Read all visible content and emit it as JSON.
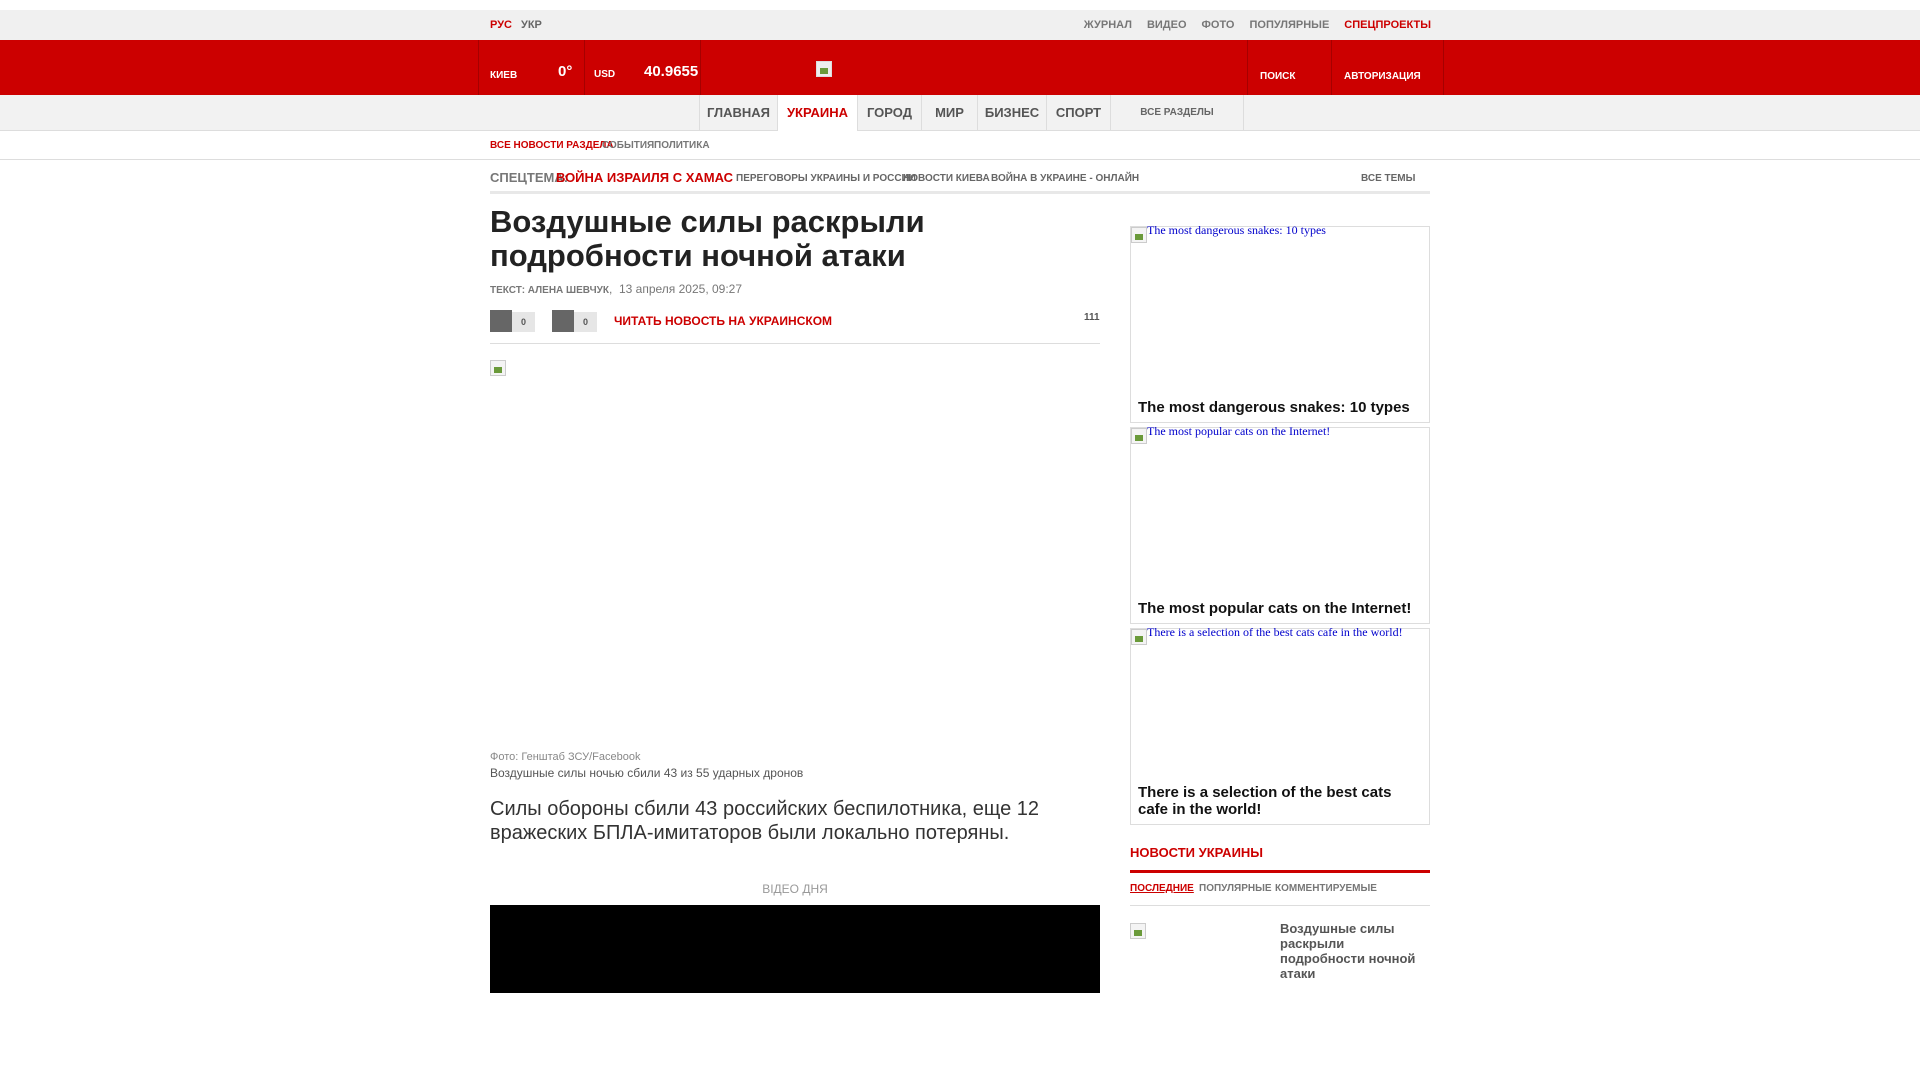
{
  "topbar": {
    "lang_ru": "РУС",
    "lang_ua": "УКР",
    "links": [
      "ЖУРНАЛ",
      "ВИДЕО",
      "ФОТО",
      "ПОПУЛЯРНЫЕ",
      "СПЕЦПРОЕКТЫ"
    ]
  },
  "header": {
    "city": "КИЕВ",
    "temperature": "0°",
    "currency": "USD",
    "rate": "40.9655",
    "search": "ПОИСК",
    "login": "АВТОРИЗАЦИЯ"
  },
  "nav": {
    "items": [
      "ГЛАВНАЯ",
      "УКРАИНА",
      "ГОРОД",
      "МИР",
      "БИЗНЕС",
      "СПОРТ"
    ],
    "all_sections": "ВСЕ РАЗДЕЛЫ"
  },
  "subnav": {
    "items": [
      "ВСЕ НОВОСТИ РАЗДЕЛА",
      "СОБЫТИЯ",
      "ПОЛИТИКА"
    ]
  },
  "spec": {
    "label": "СПЕЦТЕМА:",
    "main": "ВОЙНА ИЗРАИЛЯ С ХАМАС",
    "topics": [
      "ПЕРЕГОВОРЫ УКРАИНЫ И РОССИИ",
      "НОВОСТИ КИЕВА",
      "ВОЙНА В УКРАИНЕ - ОНЛАЙН"
    ],
    "all": "ВСЕ ТЕМЫ"
  },
  "article": {
    "title": "Воздушные силы раскрыли подробности ночной атаки",
    "author": "ТЕКСТ: АЛЕНА ШЕВЧУК",
    "date": "13 апреля 2025, 09:27",
    "share_count_1": "0",
    "share_count_2": "0",
    "read_ukr": "ЧИТАТЬ НОВОСТЬ НА УКРАИНСКОМ",
    "views": "111",
    "photo_credit": "Фото: Генштаб ЗСУ/Facebook",
    "photo_caption": "Воздушные силы ночью сбили 43 из 55 ударных дронов",
    "lead": "Силы обороны сбили 43 российских беспилотника, еще 12 вражеских БПЛА-имитаторов были локально потеряны.",
    "video_label": "ВІДЕО ДНЯ"
  },
  "cards": [
    {
      "alt": "The most dangerous snakes: 10 types",
      "title": "The most dangerous snakes: 10 types"
    },
    {
      "alt": "The most popular cats on the Internet!",
      "title": "The most popular cats on the Internet!"
    },
    {
      "alt": "There is a selection of the best cats cafe in the world!",
      "title": "There is a selection of the best cats cafe in the world!"
    }
  ],
  "news": {
    "heading": "НОВОСТИ УКРАИНЫ",
    "tabs": [
      "ПОСЛЕДНИЕ",
      "ПОПУЛЯРНЫЕ",
      "КОММЕНТИРУЕМЫЕ"
    ],
    "item_title": "Воздушные силы раскрыли подробности ночной атаки"
  },
  "colors": {
    "brand_red": "#cc0000"
  }
}
